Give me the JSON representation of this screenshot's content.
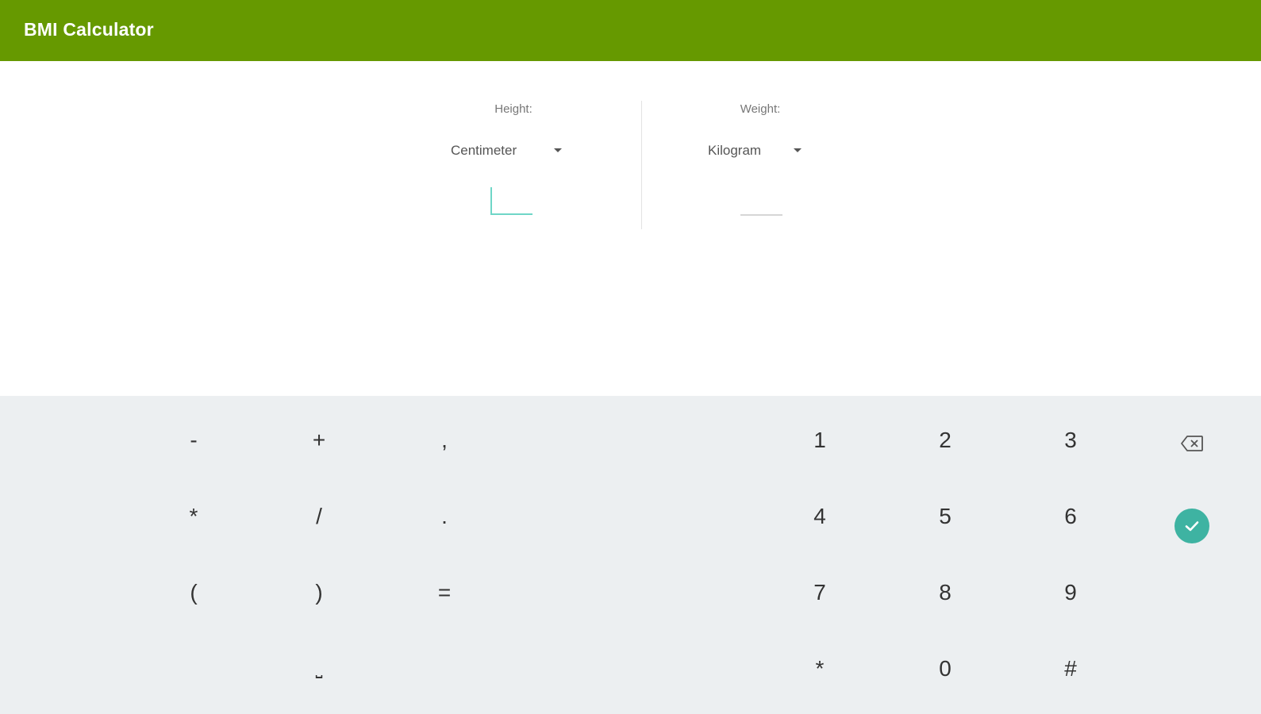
{
  "app_bar": {
    "title": "BMI Calculator",
    "color": "#669900"
  },
  "height_section": {
    "label": "Height:",
    "unit": "Centimeter",
    "value": ""
  },
  "weight_section": {
    "label": "Weight:",
    "unit": "Kilogram",
    "value": ""
  },
  "keyboard": {
    "symbols_row1": [
      "-",
      "+",
      ","
    ],
    "symbols_row2": [
      "*",
      "/",
      "."
    ],
    "symbols_row3": [
      "(",
      ")",
      "="
    ],
    "space_key": "⎵",
    "digits_row1": [
      "1",
      "2",
      "3"
    ],
    "digits_row2": [
      "4",
      "5",
      "6"
    ],
    "digits_row3": [
      "7",
      "8",
      "9"
    ],
    "digits_row4": [
      "*",
      "0",
      "#"
    ],
    "backspace_icon": "backspace-icon",
    "done_icon": "checkmark-icon",
    "accent_color": "#3eb3a2"
  }
}
